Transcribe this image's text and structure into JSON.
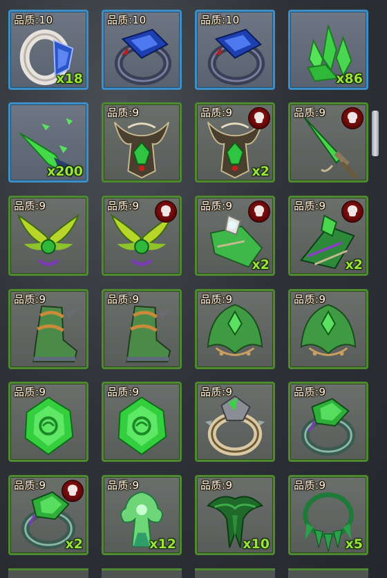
{
  "inventory": {
    "rows": [
      [
        {
          "quality": "品质:10",
          "count": "x18",
          "frame": "blue",
          "icon": "white-blue-ring-icon",
          "skull": false
        },
        {
          "quality": "品质:10",
          "count": "",
          "frame": "blue",
          "icon": "sapphire-ring-icon",
          "skull": false
        },
        {
          "quality": "品质:10",
          "count": "",
          "frame": "blue",
          "icon": "sapphire-ring-icon",
          "skull": false
        },
        {
          "quality": "",
          "count": "x86",
          "frame": "blue",
          "icon": "green-crystal-icon",
          "skull": false
        }
      ],
      [
        {
          "quality": "",
          "count": "x200",
          "frame": "blue",
          "icon": "green-shard-icon",
          "skull": false
        },
        {
          "quality": "品质:9",
          "count": "",
          "frame": "green",
          "icon": "horned-armor-icon",
          "skull": false
        },
        {
          "quality": "品质:9",
          "count": "x2",
          "frame": "green",
          "icon": "horned-armor-icon",
          "skull": true
        },
        {
          "quality": "品质:9",
          "count": "",
          "frame": "green",
          "icon": "green-sword-icon",
          "skull": true
        }
      ],
      [
        {
          "quality": "品质:9",
          "count": "",
          "frame": "green",
          "icon": "winged-amulet-icon",
          "skull": false
        },
        {
          "quality": "品质:9",
          "count": "",
          "frame": "green",
          "icon": "winged-amulet-icon",
          "skull": true
        },
        {
          "quality": "品质:9",
          "count": "x2",
          "frame": "green",
          "icon": "emerald-bracer-icon",
          "skull": true
        },
        {
          "quality": "品质:9",
          "count": "x2",
          "frame": "green",
          "icon": "emerald-gauntlet-icon",
          "skull": true
        }
      ],
      [
        {
          "quality": "品质:9",
          "count": "",
          "frame": "green",
          "icon": "green-boot-icon",
          "skull": false
        },
        {
          "quality": "品质:9",
          "count": "",
          "frame": "green",
          "icon": "green-boot-icon",
          "skull": false
        },
        {
          "quality": "品质:9",
          "count": "",
          "frame": "green",
          "icon": "green-shoulder-icon",
          "skull": false
        },
        {
          "quality": "品质:9",
          "count": "",
          "frame": "green",
          "icon": "green-shoulder-icon",
          "skull": false
        }
      ],
      [
        {
          "quality": "品质:9",
          "count": "",
          "frame": "green",
          "icon": "emerald-gem-icon",
          "skull": false
        },
        {
          "quality": "品质:9",
          "count": "",
          "frame": "green",
          "icon": "emerald-gem-icon",
          "skull": false
        },
        {
          "quality": "品质:9",
          "count": "",
          "frame": "green",
          "icon": "spiked-ring-icon",
          "skull": false
        },
        {
          "quality": "品质:9",
          "count": "",
          "frame": "green",
          "icon": "emerald-ring-icon",
          "skull": false
        }
      ],
      [
        {
          "quality": "品质:9",
          "count": "x2",
          "frame": "green",
          "icon": "emerald-ring-icon",
          "skull": true
        },
        {
          "quality": "品质:9",
          "count": "x12",
          "frame": "green",
          "icon": "green-spirit-icon",
          "skull": false
        },
        {
          "quality": "品质:9",
          "count": "x10",
          "frame": "green",
          "icon": "green-leaf-cape-icon",
          "skull": false
        },
        {
          "quality": "品质:9",
          "count": "x5",
          "frame": "green",
          "icon": "thorn-necklace-icon",
          "skull": false
        }
      ]
    ]
  },
  "colors": {
    "count_text": "#9be23a",
    "quality_text": "#ffffff",
    "green_frame": "#4e8a2f",
    "blue_frame": "#3d8fc8"
  }
}
